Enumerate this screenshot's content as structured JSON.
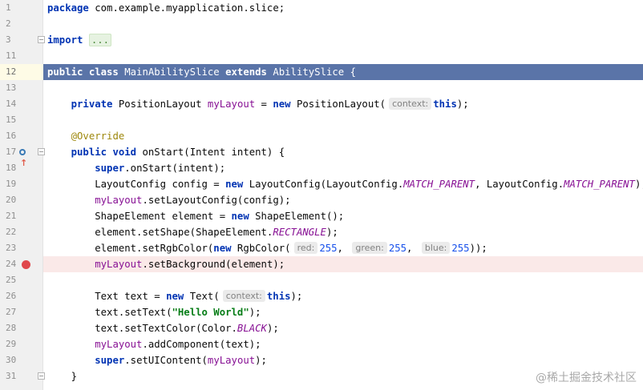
{
  "lines": [
    {
      "num": "1",
      "parts": [
        {
          "c": "kw",
          "t": "package"
        },
        {
          "t": " com.example.myapplication.slice;"
        }
      ]
    },
    {
      "num": "2",
      "parts": []
    },
    {
      "num": "3",
      "parts": [
        {
          "c": "kw",
          "t": "import"
        },
        {
          "t": " "
        },
        {
          "c": "fold-dots",
          "t": "..."
        }
      ]
    },
    {
      "num": "11",
      "parts": []
    },
    {
      "num": "12",
      "selected": true,
      "parts": [
        {
          "c": "kw",
          "t": "public class"
        },
        {
          "t": " MainAbilitySlice "
        },
        {
          "c": "kw",
          "t": "extends"
        },
        {
          "t": " AbilitySlice {"
        }
      ]
    },
    {
      "num": "13",
      "parts": []
    },
    {
      "num": "14",
      "parts": [
        {
          "t": "    "
        },
        {
          "c": "kw",
          "t": "private"
        },
        {
          "t": " PositionLayout "
        },
        {
          "c": "fld",
          "t": "myLayout"
        },
        {
          "t": " = "
        },
        {
          "c": "kw",
          "t": "new"
        },
        {
          "t": " PositionLayout("
        },
        {
          "c": "hint",
          "t": "context:"
        },
        {
          "c": "kw",
          "t": "this"
        },
        {
          "t": ");"
        }
      ]
    },
    {
      "num": "15",
      "parts": []
    },
    {
      "num": "16",
      "parts": [
        {
          "t": "    "
        },
        {
          "c": "ann",
          "t": "@Override"
        }
      ]
    },
    {
      "num": "17",
      "parts": [
        {
          "t": "    "
        },
        {
          "c": "kw",
          "t": "public void"
        },
        {
          "t": " onStart(Intent intent) {"
        }
      ]
    },
    {
      "num": "18",
      "parts": [
        {
          "t": "        "
        },
        {
          "c": "kw",
          "t": "super"
        },
        {
          "t": ".onStart(intent);"
        }
      ]
    },
    {
      "num": "19",
      "parts": [
        {
          "t": "        LayoutConfig config = "
        },
        {
          "c": "kw",
          "t": "new"
        },
        {
          "t": " LayoutConfig(LayoutConfig."
        },
        {
          "c": "sfld",
          "t": "MATCH_PARENT"
        },
        {
          "t": ", LayoutConfig."
        },
        {
          "c": "sfld",
          "t": "MATCH_PARENT"
        },
        {
          "t": ");"
        }
      ]
    },
    {
      "num": "20",
      "parts": [
        {
          "t": "        "
        },
        {
          "c": "fld",
          "t": "myLayout"
        },
        {
          "t": ".setLayoutConfig(config);"
        }
      ]
    },
    {
      "num": "21",
      "parts": [
        {
          "t": "        ShapeElement element = "
        },
        {
          "c": "kw",
          "t": "new"
        },
        {
          "t": " ShapeElement();"
        }
      ]
    },
    {
      "num": "22",
      "parts": [
        {
          "t": "        element.setShape(ShapeElement."
        },
        {
          "c": "sfld",
          "t": "RECTANGLE"
        },
        {
          "t": ");"
        }
      ]
    },
    {
      "num": "23",
      "parts": [
        {
          "t": "        element.setRgbColor("
        },
        {
          "c": "kw",
          "t": "new"
        },
        {
          "t": " RgbColor("
        },
        {
          "c": "hint",
          "t": "red:"
        },
        {
          "c": "num",
          "t": "255"
        },
        {
          "t": ", "
        },
        {
          "c": "hint",
          "t": "green:"
        },
        {
          "c": "num",
          "t": "255"
        },
        {
          "t": ", "
        },
        {
          "c": "hint",
          "t": "blue:"
        },
        {
          "c": "num",
          "t": "255"
        },
        {
          "t": "));"
        }
      ]
    },
    {
      "num": "24",
      "breakpoint": true,
      "parts": [
        {
          "t": "        "
        },
        {
          "c": "fld",
          "t": "myLayout"
        },
        {
          "t": ".setBackground(element);"
        }
      ]
    },
    {
      "num": "25",
      "parts": []
    },
    {
      "num": "26",
      "parts": [
        {
          "t": "        Text text = "
        },
        {
          "c": "kw",
          "t": "new"
        },
        {
          "t": " Text("
        },
        {
          "c": "hint",
          "t": "context:"
        },
        {
          "c": "kw",
          "t": "this"
        },
        {
          "t": ");"
        }
      ]
    },
    {
      "num": "27",
      "parts": [
        {
          "t": "        text.setText("
        },
        {
          "c": "str",
          "t": "\"Hello World\""
        },
        {
          "t": ");"
        }
      ]
    },
    {
      "num": "28",
      "parts": [
        {
          "t": "        text.setTextColor(Color."
        },
        {
          "c": "sfld",
          "t": "BLACK"
        },
        {
          "t": ");"
        }
      ]
    },
    {
      "num": "29",
      "parts": [
        {
          "t": "        "
        },
        {
          "c": "fld",
          "t": "myLayout"
        },
        {
          "t": ".addComponent(text);"
        }
      ]
    },
    {
      "num": "30",
      "parts": [
        {
          "t": "        "
        },
        {
          "c": "kw",
          "t": "super"
        },
        {
          "t": ".setUIContent("
        },
        {
          "c": "fld",
          "t": "myLayout"
        },
        {
          "t": ");"
        }
      ]
    },
    {
      "num": "31",
      "parts": [
        {
          "t": "    }"
        }
      ]
    }
  ],
  "watermark": "@稀土掘金技术社区",
  "icons": {
    "breakpoint": "breakpoint-icon",
    "override": "override-method-icon",
    "fold": "fold-icon"
  },
  "colors": {
    "selection": "#5a74a8",
    "keyword": "#0033b3",
    "field": "#871094",
    "annotation": "#9e880d",
    "string": "#067d17",
    "number": "#1750eb",
    "breakpoint": "#e0474c",
    "breakpoint_line": "#fae9e8"
  }
}
